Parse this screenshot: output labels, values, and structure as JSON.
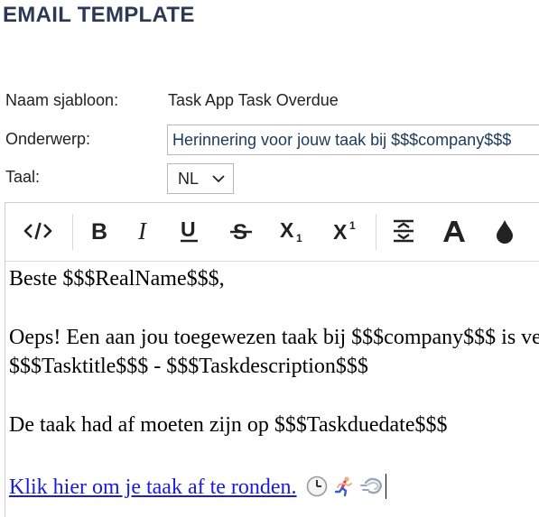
{
  "page": {
    "title": "EMAIL TEMPLATE"
  },
  "form": {
    "name_label": "Naam sjabloon:",
    "name_value": "Task App Task Overdue",
    "subject_label": "Onderwerp:",
    "subject_value": "Herinnering voor jouw taak bij $$$company$$$",
    "language_label": "Taal:",
    "language_value": "NL"
  },
  "toolbar": {
    "buttons": [
      {
        "icon": "code-view-icon"
      },
      {
        "icon": "bold-icon"
      },
      {
        "icon": "italic-icon"
      },
      {
        "icon": "underline-icon"
      },
      {
        "icon": "strikethrough-icon"
      },
      {
        "icon": "subscript-icon"
      },
      {
        "icon": "superscript-icon"
      },
      {
        "icon": "line-height-icon"
      },
      {
        "icon": "font-color-icon"
      },
      {
        "icon": "highlight-color-icon"
      }
    ]
  },
  "editor": {
    "line1": "Beste $$$RealName$$$,",
    "line2": "Oeps! Een aan jou toegewezen taak bij $$$company$$$ is verlopen:",
    "line3": "$$$Tasktitle$$$ - $$$Taskdescription$$$",
    "line4": "De taak had af moeten zijn op $$$Taskduedate$$$",
    "link_text": "Klik hier om je taak af te ronden.",
    "emojis": [
      "clock-icon",
      "runner-icon",
      "dash-icon"
    ]
  }
}
